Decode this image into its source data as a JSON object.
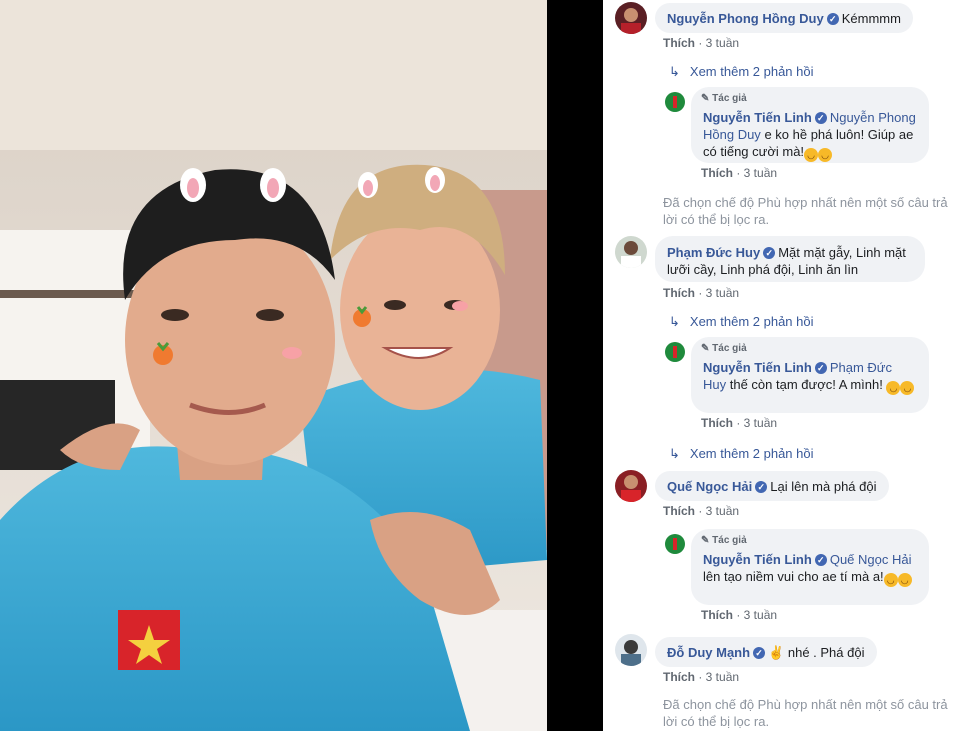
{
  "colors": {
    "link": "#385898",
    "bubble": "#f0f2f5",
    "meta": "#606770",
    "verified": "#4267b2"
  },
  "photo": {
    "description_icon": "selfie-photo"
  },
  "comments": [
    {
      "author": "Nguyễn Phong Hồng Duy",
      "text": "Kémmmm",
      "like": "Thích",
      "time": "3 tuần"
    },
    {
      "author": "Phạm Đức Huy",
      "text": "Mặt mặt gẫy, Linh mặt lưỡi cầy, Linh phá đội, Linh ăn lìn",
      "like": "Thích",
      "time": "3 tuần"
    },
    {
      "author": "Quế Ngọc Hải",
      "text": "Lại lên mà phá đội",
      "like": "Thích",
      "time": "3 tuần"
    },
    {
      "author": "Đỗ Duy Mạnh",
      "text": "✌️ nhé . Phá đội",
      "like": "Thích",
      "time": "3 tuần"
    }
  ],
  "replies": [
    {
      "badge": "Tác giả",
      "author": "Nguyễn Tiến Linh",
      "mention": "Nguyễn Phong Hồng Duy",
      "text": "e ko hề phá luôn! Giúp ae có tiếng cười mà!",
      "like": "Thích",
      "time": "3 tuần"
    },
    {
      "badge": "Tác giả",
      "author": "Nguyễn Tiến Linh",
      "mention": "Phạm Đức Huy",
      "text": "thế còn tạm được! A mình!",
      "like": "Thích",
      "time": "3 tuần"
    },
    {
      "badge": "Tác giả",
      "author": "Nguyễn Tiến Linh",
      "mention": "Quế Ngọc Hải",
      "text": "lên tạo niềm vui cho ae tí mà a!",
      "like": "Thích",
      "time": "3 tuần"
    }
  ],
  "more_replies": "Xem thêm 2 phản hồi",
  "notice": "Đã chọn chế độ Phù hợp nhất nên một số câu trả lời có thể bị lọc ra."
}
